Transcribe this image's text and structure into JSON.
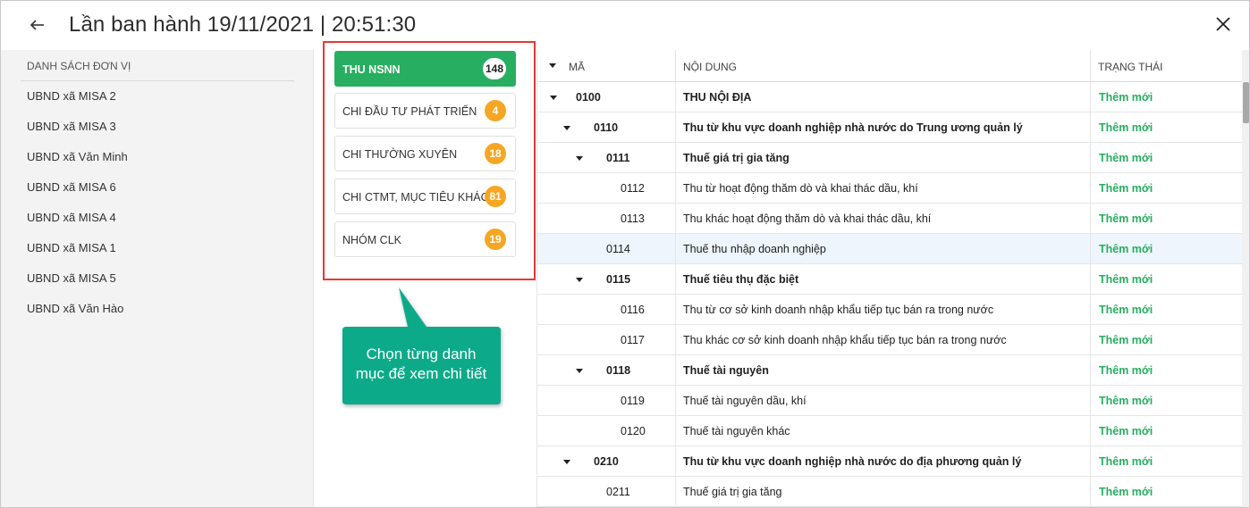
{
  "header": {
    "title": "Lần ban hành 19/11/2021 | 20:51:30"
  },
  "units": {
    "header": "DANH SÁCH ĐƠN VỊ",
    "items": [
      "UBND xã MISA 2",
      "UBND xã MISA 3",
      "UBND xã Văn Minh",
      "UBND xã MISA 6",
      "UBND xã MISA 4",
      "UBND xã MISA 1",
      "UBND xã MISA 5",
      "UBND xã Văn Hào"
    ]
  },
  "categories": [
    {
      "label": "THU NSNN",
      "count": "148",
      "active": true
    },
    {
      "label": "CHI ĐẦU TƯ PHÁT TRIỂN",
      "count": "4",
      "active": false
    },
    {
      "label": "CHI THƯỜNG XUYÊN",
      "count": "18",
      "active": false
    },
    {
      "label": "CHI CTMT, MỤC TIÊU KHÁC",
      "count": "81",
      "active": false
    },
    {
      "label": "NHÓM CLK",
      "count": "19",
      "active": false
    }
  ],
  "callout": {
    "line1": "Chọn từng danh",
    "line2": "mục để xem chi tiết"
  },
  "table": {
    "columns": {
      "code": "MÃ",
      "content": "NỘI DUNG",
      "status": "TRẠNG THÁI"
    },
    "rows": [
      {
        "code": "0100",
        "content": "THU NỘI ĐỊA",
        "status": "Thêm mới",
        "level": 0,
        "expandable": true
      },
      {
        "code": "0110",
        "content": "Thu từ khu vực doanh nghiệp nhà nước do Trung ương quản lý",
        "status": "Thêm mới",
        "level": 1,
        "expandable": true
      },
      {
        "code": "0111",
        "content": "Thuế giá trị gia tăng",
        "status": "Thêm mới",
        "level": 2,
        "expandable": true
      },
      {
        "code": "0112",
        "content": "Thu từ hoạt động thăm dò và khai thác dầu, khí",
        "status": "Thêm mới",
        "level": 3,
        "expandable": false
      },
      {
        "code": "0113",
        "content": "Thu khác hoạt động thăm dò và khai thác dầu, khí",
        "status": "Thêm mới",
        "level": 3,
        "expandable": false
      },
      {
        "code": "0114",
        "content": "Thuế thu nhập doanh nghiệp",
        "status": "Thêm mới",
        "level": 2,
        "expandable": false,
        "selected": true
      },
      {
        "code": "0115",
        "content": "Thuế tiêu thụ đặc biệt",
        "status": "Thêm mới",
        "level": 2,
        "expandable": true
      },
      {
        "code": "0116",
        "content": "Thu từ cơ sở kinh doanh nhập khẩu tiếp tục bán ra trong nước",
        "status": "Thêm mới",
        "level": 3,
        "expandable": false
      },
      {
        "code": "0117",
        "content": "Thu khác cơ sở kinh doanh nhập khẩu tiếp tục bán ra trong nước",
        "status": "Thêm mới",
        "level": 3,
        "expandable": false
      },
      {
        "code": "0118",
        "content": "Thuế tài nguyên",
        "status": "Thêm mới",
        "level": 2,
        "expandable": true
      },
      {
        "code": "0119",
        "content": "Thuế tài nguyên dầu, khí",
        "status": "Thêm mới",
        "level": 3,
        "expandable": false
      },
      {
        "code": "0120",
        "content": "Thuế tài nguyên khác",
        "status": "Thêm mới",
        "level": 3,
        "expandable": false
      },
      {
        "code": "0210",
        "content": "Thu từ khu vực doanh nghiệp nhà nước do địa phương quản lý",
        "status": "Thêm mới",
        "level": 1,
        "expandable": true
      },
      {
        "code": "0211",
        "content": "Thuế giá trị gia tăng",
        "status": "Thêm mới",
        "level": 2,
        "expandable": false
      }
    ]
  },
  "icons": {
    "back": "back-arrow-icon",
    "close": "close-icon",
    "expand": "caret-down-icon"
  },
  "colors": {
    "accent_green": "#27ae60",
    "badge_orange": "#f5a623",
    "highlight_red": "#e53935",
    "callout_teal": "#0faa8a"
  }
}
